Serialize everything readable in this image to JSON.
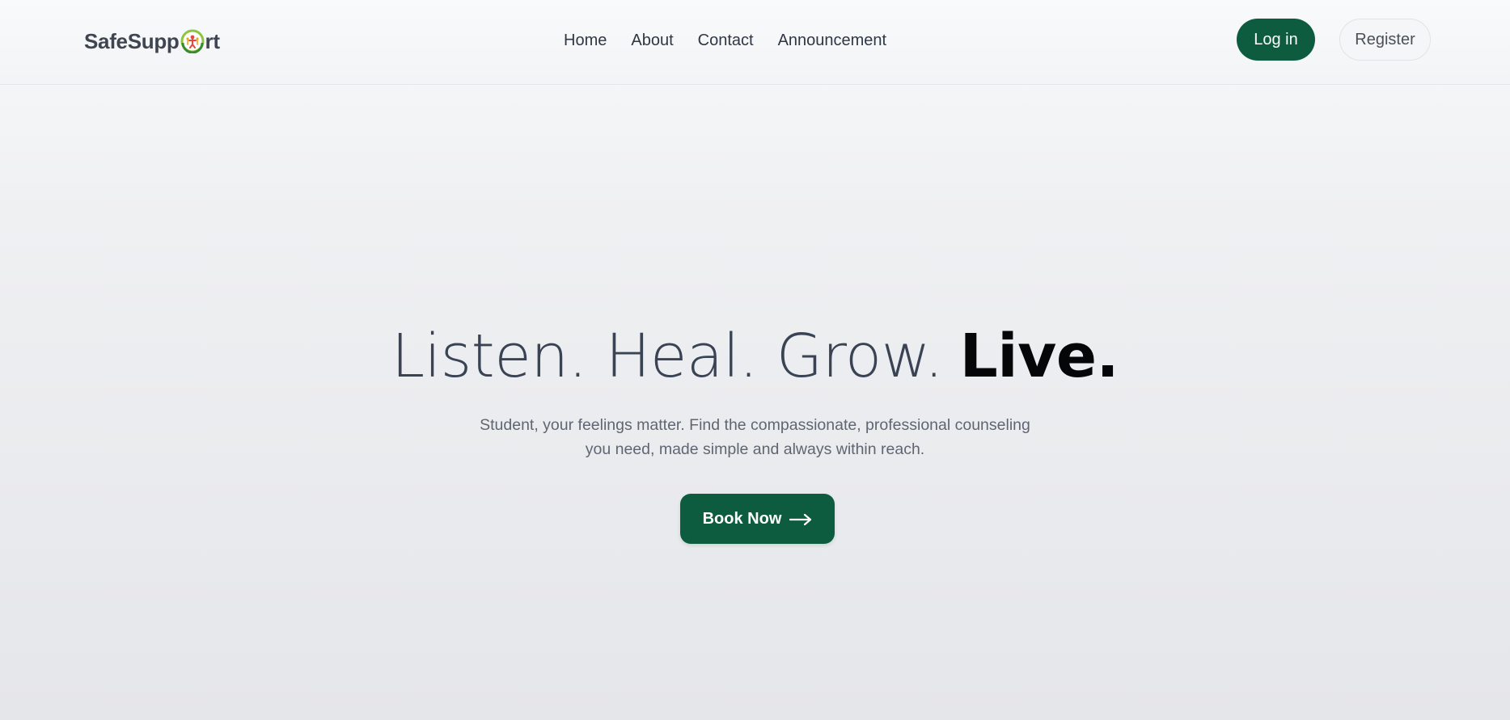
{
  "brand": {
    "name_before": "SafeSupp",
    "name_after": "rt",
    "logo_icon": "globe-people-icon"
  },
  "nav": {
    "items": [
      {
        "label": "Home"
      },
      {
        "label": "About"
      },
      {
        "label": "Contact"
      },
      {
        "label": "Announcement"
      }
    ]
  },
  "auth": {
    "login_label": "Log in",
    "register_label": "Register"
  },
  "hero": {
    "title_light": "Listen. Heal. Grow.",
    "title_bold": "Live.",
    "subtitle": "Student, your feelings matter. Find the compassionate, professional counseling you need, made simple and always within reach.",
    "cta_label": "Book Now",
    "cta_icon": "arrow-right-icon"
  },
  "colors": {
    "primary": "#0d5c40",
    "text_dark": "#384152",
    "text_muted": "#5f6672",
    "background": "#eff0f2"
  }
}
